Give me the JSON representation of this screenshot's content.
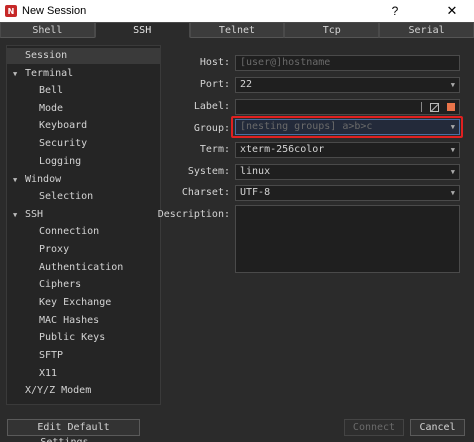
{
  "window": {
    "title": "New Session",
    "help": "?",
    "close": "✕",
    "app_icon": "N"
  },
  "tabs": [
    {
      "label": "Shell",
      "active": false
    },
    {
      "label": "SSH",
      "active": true
    },
    {
      "label": "Telnet",
      "active": false
    },
    {
      "label": "Tcp",
      "active": false
    },
    {
      "label": "Serial",
      "active": false
    }
  ],
  "tree": {
    "session": "Session",
    "terminal": "Terminal",
    "bell": "Bell",
    "mode": "Mode",
    "keyboard": "Keyboard",
    "security": "Security",
    "logging": "Logging",
    "window": "Window",
    "selection": "Selection",
    "ssh": "SSH",
    "connection": "Connection",
    "proxy": "Proxy",
    "authentication": "Authentication",
    "ciphers": "Ciphers",
    "key_exchange": "Key Exchange",
    "mac_hashes": "MAC Hashes",
    "public_keys": "Public Keys",
    "sftp": "SFTP",
    "x11": "X11",
    "xyz_modem": "X/Y/Z Modem"
  },
  "form": {
    "host_label": "Host:",
    "host_placeholder": "[user@]hostname",
    "port_label": "Port:",
    "port_value": "22",
    "label_label": "Label:",
    "label_value": "",
    "group_label": "Group:",
    "group_placeholder": "[nesting groups] a>b>c",
    "term_label": "Term:",
    "term_value": "xterm-256color",
    "system_label": "System:",
    "system_value": "linux",
    "charset_label": "Charset:",
    "charset_value": "UTF-8",
    "description_label": "Description:"
  },
  "buttons": {
    "edit_defaults": "Edit Default Settings...",
    "connect": "Connect",
    "cancel": "Cancel"
  },
  "colors": {
    "highlight": "#e02020",
    "label_color_swatch": "#e8744a"
  }
}
